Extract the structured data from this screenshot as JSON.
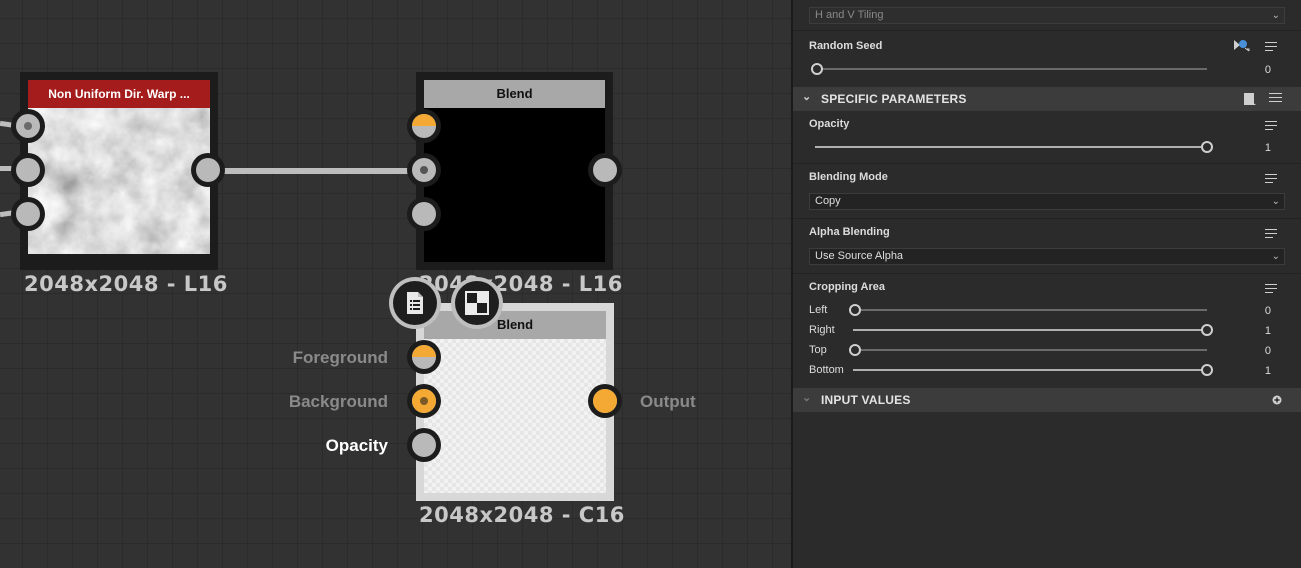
{
  "graph": {
    "node1": {
      "title": "Non Uniform Dir. Warp ...",
      "resolution": "2048x2048 - L16",
      "title_color": "#a51c1c"
    },
    "node2": {
      "title": "Blend",
      "resolution": "2048x2048 - L16"
    },
    "node3": {
      "title": "Blend",
      "resolution": "2048x2048 - C16",
      "ports": {
        "foreground": "Foreground",
        "background": "Background",
        "opacity": "Opacity",
        "output": "Output"
      }
    },
    "context_buttons": [
      "document-list-icon",
      "checker-icon"
    ],
    "accent": "#f4a934"
  },
  "panel": {
    "tiling": {
      "value": "H and V Tiling"
    },
    "random_seed": {
      "label": "Random Seed",
      "value": "0",
      "fraction": 0
    },
    "specific_section": {
      "title": "SPECIFIC PARAMETERS"
    },
    "opacity": {
      "label": "Opacity",
      "value": "1",
      "fraction": 1
    },
    "blending_mode": {
      "label": "Blending Mode",
      "value": "Copy"
    },
    "alpha_blending": {
      "label": "Alpha Blending",
      "value": "Use Source Alpha"
    },
    "cropping": {
      "label": "Cropping Area",
      "left": {
        "label": "Left",
        "value": "0",
        "fraction": 0
      },
      "right": {
        "label": "Right",
        "value": "1",
        "fraction": 1
      },
      "top": {
        "label": "Top",
        "value": "0",
        "fraction": 0
      },
      "bottom": {
        "label": "Bottom",
        "value": "1",
        "fraction": 1
      }
    },
    "input_section": {
      "title": "INPUT VALUES"
    }
  }
}
